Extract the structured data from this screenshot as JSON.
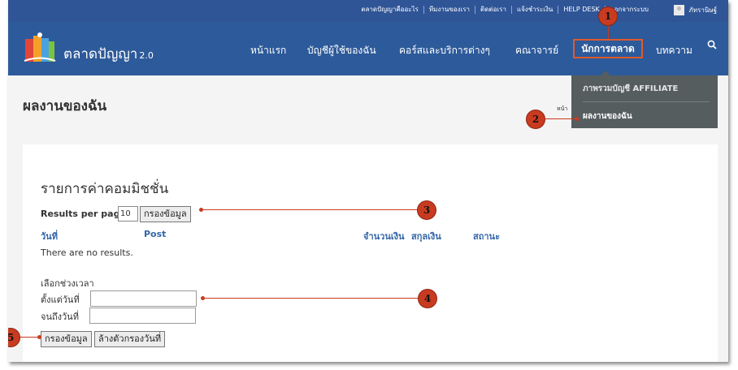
{
  "topbar": {
    "links": [
      "ตลาดปัญญาคืออะไร",
      "ทีมงานของเรา",
      "ติดต่อเรา",
      "แจ้งชำระเงิน",
      "HELP DESK",
      "ออกจากระบบ"
    ],
    "user_name": "ภัทรานิษฐ์"
  },
  "brand": {
    "name": "ตลาดปัญญา",
    "version": "2.0",
    "bar_color": "#2d5a9a",
    "accent_color": "#e05a2c"
  },
  "nav": {
    "items": [
      "หน้าแรก",
      "บัญชีผู้ใช้ของฉัน",
      "คอร์สและบริการต่างๆ",
      "คณาจารย์"
    ],
    "active": "นักการตลาด",
    "last": "บทความ"
  },
  "dropdown": {
    "items": [
      "ภาพรวมบัญชี AFFILIATE",
      "ผลงานของฉัน"
    ]
  },
  "page": {
    "title": "ผลงานของฉัน",
    "breadcrumb_fragment": "หน้า"
  },
  "commission": {
    "title": "รายการค่าคอมมิชชั่น",
    "per_page_label": "Results per page",
    "per_page_value": "10",
    "filter_button": "กรองข้อมูล",
    "columns": [
      "วันที่",
      "Post",
      "จำนวนเงิน",
      "สกุลเงิน",
      "สถานะ"
    ],
    "empty_text": "There are no results."
  },
  "date_filter": {
    "section_label": "เลือกช่วงเวลา",
    "from_label": "ตั้งแต่วันที่",
    "to_label": "จนถึงวันที่",
    "filter_button": "กรองข้อมูล",
    "clear_button": "ล้างตัวกรองวันที่"
  },
  "callouts": [
    "1",
    "2",
    "3",
    "4",
    "5"
  ]
}
